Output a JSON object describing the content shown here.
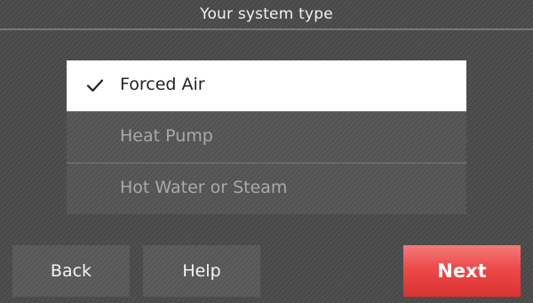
{
  "header": {
    "title": "Your system type"
  },
  "options": [
    {
      "label": "Forced Air",
      "selected": true,
      "icon": "check-icon"
    },
    {
      "label": "Heat Pump",
      "selected": false
    },
    {
      "label": "Hot Water or Steam",
      "selected": false
    }
  ],
  "buttons": {
    "back_label": "Back",
    "help_label": "Help",
    "next_label": "Next"
  },
  "colors": {
    "accent": "#ec4a4a",
    "background": "#4a4a4a",
    "selected_row": "#ffffff"
  }
}
